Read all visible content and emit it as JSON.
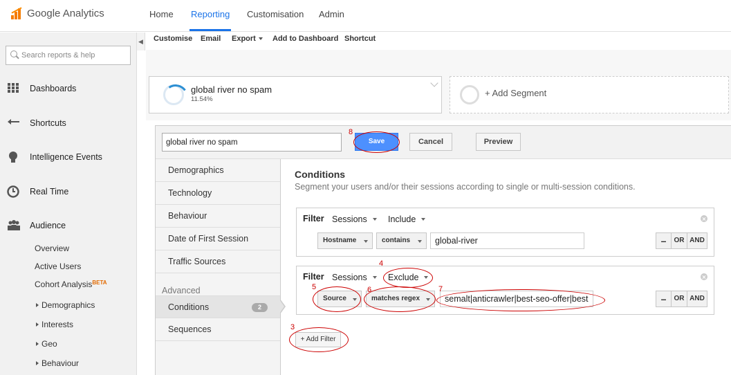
{
  "app": {
    "name": "Google Analytics"
  },
  "topnav": [
    {
      "label": "Home"
    },
    {
      "label": "Reporting"
    },
    {
      "label": "Customisation"
    },
    {
      "label": "Admin"
    }
  ],
  "sidebar": {
    "search_placeholder": "Search reports & help",
    "main": [
      {
        "label": "Dashboards",
        "icon": "grid-icon"
      },
      {
        "label": "Shortcuts",
        "icon": "shortcut-arrow-icon"
      },
      {
        "label": "Intelligence Events",
        "icon": "lightbulb-icon"
      },
      {
        "label": "Real Time",
        "icon": "clock-icon"
      },
      {
        "label": "Audience",
        "icon": "people-icon"
      }
    ],
    "audience_items": [
      "Overview",
      "Active Users",
      "Cohort Analysis"
    ],
    "beta": "BETA",
    "audience_groups": [
      "Demographics",
      "Interests",
      "Geo",
      "Behaviour"
    ]
  },
  "toolbar": {
    "customise": "Customise",
    "email": "Email",
    "export": "Export",
    "add_to_dashboard": "Add to Dashboard",
    "shortcut": "Shortcut"
  },
  "segments": {
    "active": {
      "name": "global river no spam",
      "percent": "11.54%"
    },
    "add": "+ Add Segment"
  },
  "editor": {
    "name_value": "global river no spam",
    "save": "Save",
    "cancel": "Cancel",
    "preview": "Preview",
    "categories": [
      "Demographics",
      "Technology",
      "Behaviour",
      "Date of First Session",
      "Traffic Sources"
    ],
    "advanced_label": "Advanced",
    "advanced": [
      {
        "label": "Conditions",
        "badge": "2"
      },
      {
        "label": "Sequences"
      }
    ],
    "conditions_title": "Conditions",
    "conditions_desc": "Segment your users and/or their sessions according to single or multi-session conditions.",
    "filters": [
      {
        "label": "Filter",
        "scope": "Sessions",
        "mode": "Include",
        "dimension": "Hostname",
        "operator": "contains",
        "value": "global-river"
      },
      {
        "label": "Filter",
        "scope": "Sessions",
        "mode": "Exclude",
        "dimension": "Source",
        "operator": "matches regex",
        "value": "semalt|anticrawler|best-seo-offer|best-"
      }
    ],
    "ops": {
      "minus": "–",
      "or": "OR",
      "and": "AND"
    },
    "add_filter": "+ Add Filter"
  },
  "annotations": [
    "3",
    "4",
    "5",
    "6",
    "7",
    "8"
  ],
  "colors": {
    "accent": "#1a73e8",
    "save_button": "#4d90fe",
    "annotation": "#cc0000",
    "logo": "#f57c00"
  }
}
